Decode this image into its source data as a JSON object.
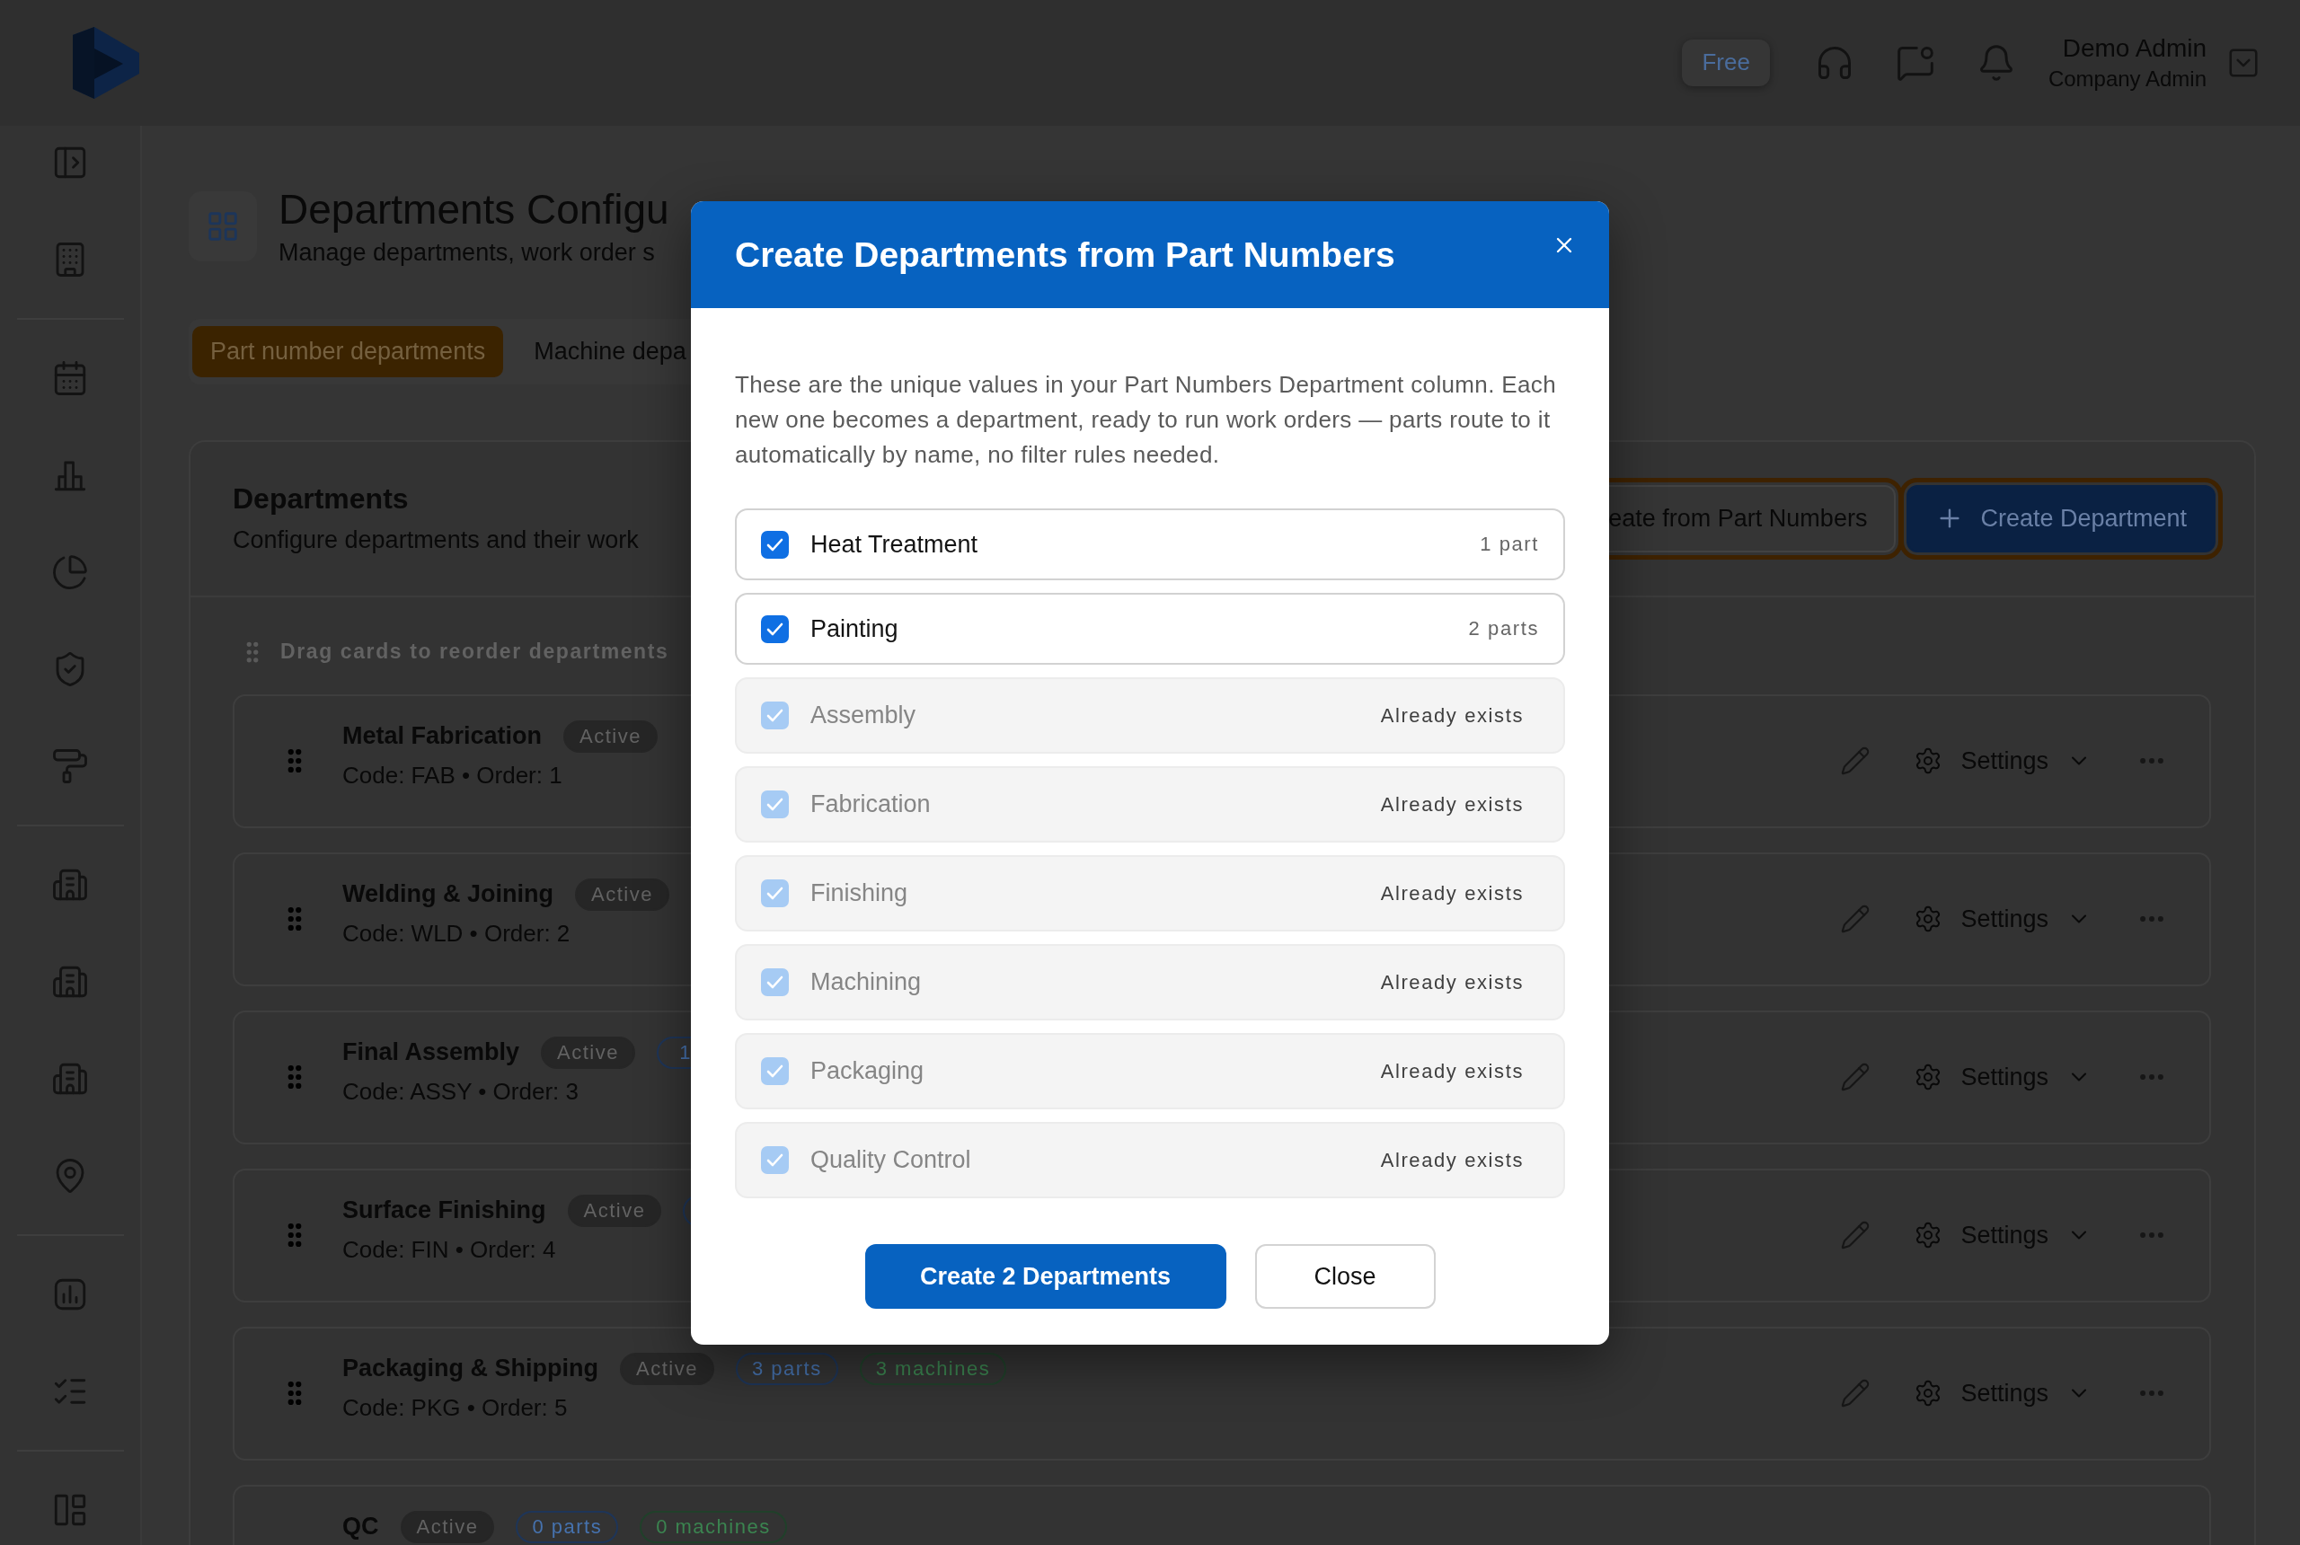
{
  "header": {
    "plan_badge": "Free",
    "user": {
      "name": "Demo Admin",
      "role": "Company Admin"
    }
  },
  "page": {
    "title": "Departments Configu",
    "subtitle": "Manage departments, work order s"
  },
  "tabs": [
    {
      "label": "Part number departments",
      "selected": true
    },
    {
      "label": "Machine depa",
      "selected": false
    }
  ],
  "panel": {
    "title": "Departments",
    "subtitle": "Configure departments and their work",
    "actions": [
      {
        "kind": "secondary",
        "label": "eate from Part Numbers"
      },
      {
        "kind": "primary",
        "label": "Create Department"
      }
    ],
    "hint": "Drag cards to reorder departments"
  },
  "departments": [
    {
      "name": "Metal Fabrication",
      "meta": "Code: FAB • Order: 1",
      "badges": [
        {
          "kind": "status",
          "label": "Active"
        }
      ],
      "settings_label": "Settings"
    },
    {
      "name": "Welding & Joining",
      "meta": "Code: WLD • Order: 2",
      "badges": [
        {
          "kind": "status",
          "label": "Active"
        }
      ],
      "settings_label": "Settings"
    },
    {
      "name": "Final Assembly",
      "meta": "Code: ASSY • Order: 3",
      "badges": [
        {
          "kind": "status",
          "label": "Active"
        },
        {
          "kind": "parts",
          "label": "1"
        }
      ],
      "settings_label": "Settings"
    },
    {
      "name": "Surface Finishing",
      "meta": "Code: FIN • Order: 4",
      "badges": [
        {
          "kind": "status",
          "label": "Active"
        },
        {
          "kind": "parts"
        }
      ],
      "settings_label": "Settings"
    },
    {
      "name": "Packaging & Shipping",
      "meta": "Code: PKG • Order: 5",
      "badges": [
        {
          "kind": "status",
          "label": "Active"
        },
        {
          "kind": "parts",
          "label": "3 parts"
        },
        {
          "kind": "machines",
          "label": "3 machines"
        }
      ],
      "settings_label": "Settings"
    },
    {
      "name": "QC",
      "badges": [
        {
          "kind": "status",
          "label": "Active"
        },
        {
          "kind": "parts",
          "label": "0 parts"
        },
        {
          "kind": "machines",
          "label": "0 machines"
        }
      ]
    }
  ],
  "dialog": {
    "title": "Create Departments from Part Numbers",
    "description": "These are the unique values in your Part Numbers Department column. Each new one becomes a department, ready to run work orders — parts route to it automatically by name, no filter rules needed.",
    "items": [
      {
        "name": "Heat Treatment",
        "note": "1 part",
        "checked": true,
        "disabled": false
      },
      {
        "name": "Painting",
        "note": "2 parts",
        "checked": true,
        "disabled": false
      },
      {
        "name": "Assembly",
        "note": "Already exists",
        "checked": true,
        "disabled": true
      },
      {
        "name": "Fabrication",
        "note": "Already exists",
        "checked": true,
        "disabled": true
      },
      {
        "name": "Finishing",
        "note": "Already exists",
        "checked": true,
        "disabled": true
      },
      {
        "name": "Machining",
        "note": "Already exists",
        "checked": true,
        "disabled": true
      },
      {
        "name": "Packaging",
        "note": "Already exists",
        "checked": true,
        "disabled": true
      },
      {
        "name": "Quality Control",
        "note": "Already exists",
        "checked": true,
        "disabled": true
      }
    ],
    "buttons": [
      {
        "kind": "primary",
        "label": "Create 2 Departments"
      },
      {
        "kind": "secondary",
        "label": "Close"
      }
    ]
  }
}
